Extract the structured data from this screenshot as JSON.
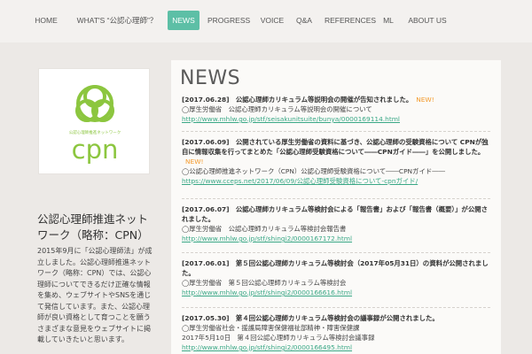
{
  "nav": {
    "items": [
      {
        "label": "HOME"
      },
      {
        "label": "WHAT'S “公認心理師”？"
      },
      {
        "label": "NEWS"
      },
      {
        "label": "PROGRESS"
      },
      {
        "label": "VOICE"
      },
      {
        "label": "Q&A"
      },
      {
        "label": "REFERENCES"
      },
      {
        "label": "ML"
      },
      {
        "label": "ABOUT US"
      }
    ]
  },
  "logo": {
    "tagline": "公認心理師推進ネットワーク",
    "wordmark": "cpn",
    "color": "#8cc63f"
  },
  "sidebar": {
    "title": "公認心理師推進ネットワーク（略称：CPN）",
    "text": "2015年9月に「公認心理師法」が成立しました。公認心理師推進ネットワーク（略称：CPN）では、公認心理師についてできるだけ正確な情報を集め、ウェブサイトやSNSを通じて発信しています。また、公認心理師が良い資格として育つことを願うさまざまな意見をウェブサイトに掲載していきたいと思います。"
  },
  "main": {
    "heading": "NEWS",
    "new_label": "NEW!",
    "entries": [
      {
        "headline": "[2017.06.28]　公認心理師カリキュラム等説明会の開催が告知されました。",
        "is_new": true,
        "body": "◯厚生労働省　公認心理師カリキュラム等説明会の開催について",
        "link": "http://www.mhlw.go.jp/stf/seisakunitsuite/bunya/0000169114.html"
      },
      {
        "headline": "[2017.06.09]　公開されている厚生労働省の資料に基づき、公認心理師の受験資格について CPNが独自に情報収集を行ってまとめた「公認心理師受験資格について――CPNガイド――」を公開しました。",
        "is_new": true,
        "body": "◯公認心理師推進ネットワーク（CPN）公認心理師受験資格について――CPNガイド――",
        "link": "https://www.cceps.net/2017/06/09/公認心理師受験資格について-cpnガイド/"
      },
      {
        "headline": "[2017.06.07]　公認心理師カリキュラム等検討会による「報告書」および「報告書（概要）」が公開されました。",
        "is_new": false,
        "body": "◯厚生労働省　公認心理師カリキュラム等検討会報告書",
        "link": "http://www.mhlw.go.jp/stf/shingi2/0000167172.html"
      },
      {
        "headline": "[2017.06.01]　第５回公認心理師カリキュラム等検討会（2017年05月31日）の資料が公開されました。",
        "is_new": false,
        "body": "◯厚生労働省　第５回公認心理師カリキュラム等検討会",
        "link": "http://www.mhlw.go.jp/stf/shingi2/0000166616.html"
      },
      {
        "headline": "[2017.05.30]　第４回公認心理師カリキュラム等検討会の議事録が公開されました。",
        "is_new": false,
        "body": "◯厚生労働省社会・援護局障害保健福祉部精神・障害保健課",
        "body2": "2017年5月10日　第４回公認心理師カリキュラム等検討会議事録",
        "link": "http://www.mhlw.go.jp/stf/shingi2/0000166495.html"
      }
    ]
  }
}
